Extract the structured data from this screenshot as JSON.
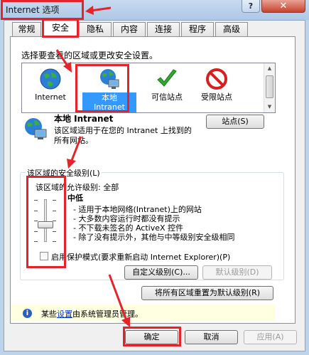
{
  "window": {
    "title": "Internet 选项",
    "help_label": "?",
    "close_label": "✕"
  },
  "tabs": [
    {
      "label": "常规"
    },
    {
      "label": "安全",
      "active": true
    },
    {
      "label": "隐私"
    },
    {
      "label": "内容"
    },
    {
      "label": "连接"
    },
    {
      "label": "程序"
    },
    {
      "label": "高级"
    }
  ],
  "zone_prompt": "选择要查看的区域或更改安全设置。",
  "zones": [
    {
      "label": "Internet",
      "icon": "globe-icon"
    },
    {
      "label": "本地\nIntranet",
      "icon": "intranet-icon",
      "selected": true
    },
    {
      "label": "可信站点",
      "icon": "checkmark-icon"
    },
    {
      "label": "受限站点",
      "icon": "no-entry-icon"
    }
  ],
  "zone_info": {
    "title": "本地 Intranet",
    "description": "该区域适用于在您的 Intranet 上找到的所有网站。",
    "sites_button": "站点(S)"
  },
  "security_level": {
    "group_label": "该区域的安全级别(L)",
    "allowed_levels": "该区域的允许级别: 全部",
    "level_name": "中低",
    "level_fraction": 0.4,
    "bullets": [
      "- 适用于本地网络(Intranet)上的网站",
      "- 大多数内容运行时都没有提示",
      "- 不下载未签名的 ActiveX 控件",
      "- 除了没有提示外，其他与中等级别安全级相同"
    ],
    "protected_mode_label": "启用保护模式(要求重新启动 Internet Explorer)(P)",
    "protected_mode_checked": false,
    "custom_level_button": "自定义级别(C)...",
    "default_level_button": "默认级别(D)",
    "reset_all_button": "将所有区域重置为默认级别(R)"
  },
  "info_bar": {
    "prefix": "某些",
    "link": "设置",
    "suffix": "由系统管理员管理。"
  },
  "footer": {
    "ok": "确定",
    "cancel": "取消",
    "apply": "应用(A)"
  },
  "colors": {
    "annotation": "#e4232b",
    "selection": "#3399ff",
    "info_bar": "#ffffe1"
  }
}
